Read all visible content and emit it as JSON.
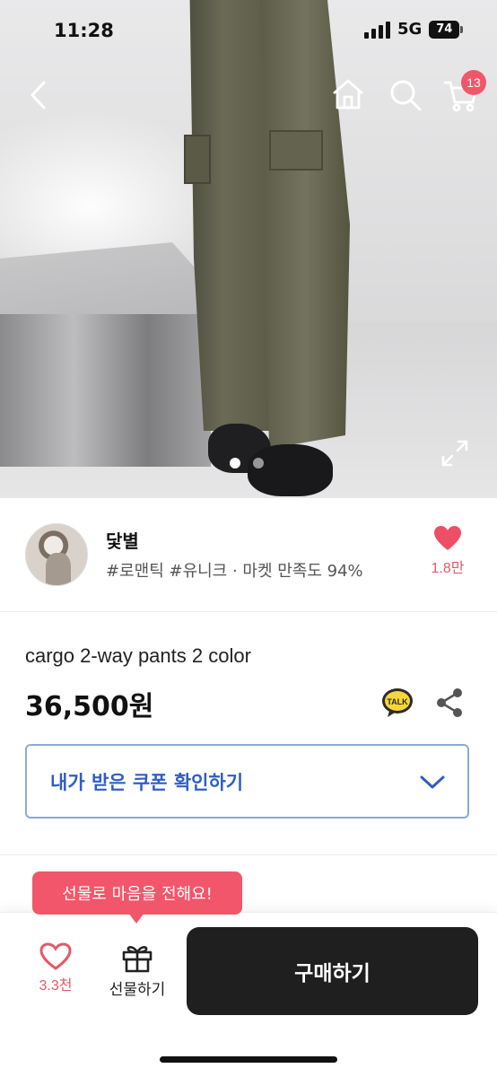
{
  "status_bar": {
    "time": "11:28",
    "network": "5G",
    "battery": "74"
  },
  "nav": {
    "back_icon": "chevron-left-icon",
    "home_icon": "home-icon",
    "search_icon": "search-icon",
    "cart_icon": "cart-icon",
    "cart_badge": "13"
  },
  "gallery": {
    "image_count": 2,
    "active_index": 0,
    "expand_icon": "expand-icon"
  },
  "shop": {
    "name": "닻별",
    "tags": "#로맨틱 #유니크 · 마켓 만족도 94%",
    "like_count": "1.8만"
  },
  "product": {
    "name": "cargo 2-way pants 2 color",
    "price": "36,500원"
  },
  "coupon": {
    "label": "내가 받은 쿠폰 확인하기"
  },
  "bottom_bar": {
    "tooltip": "선물로 마음을 전해요!",
    "wish_count": "3.3천",
    "gift_label": "선물하기",
    "buy_label": "구매하기"
  },
  "colors": {
    "accent_red": "#f2566a",
    "heart_red": "#e25a6b",
    "coupon_blue": "#2f5ec4",
    "coupon_border": "#8fa8d6",
    "buy_button": "#1f1f1f"
  }
}
